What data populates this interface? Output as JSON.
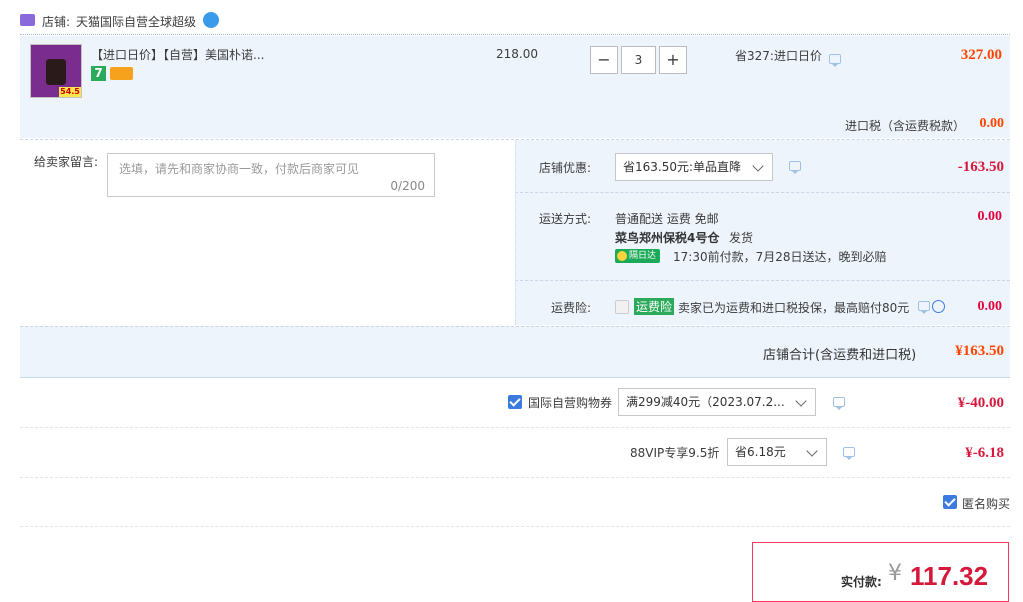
{
  "shop": {
    "label": "店铺:",
    "name": "天猫国际自营全球超级"
  },
  "item": {
    "title": "【进口日价】【自营】美国朴诺...",
    "price": "218.00",
    "qty": "3",
    "minus": "−",
    "plus": "+",
    "save_note": "省327:进口日价",
    "subtotal": "327.00",
    "thumb_price": "54.5",
    "badge7": "7"
  },
  "tax": {
    "label": "进口税（含运费税款）",
    "value": "0.00"
  },
  "message": {
    "label": "给卖家留言:",
    "placeholder": "选填，请先和商家协商一致，付款后商家可见",
    "counter": "0/200"
  },
  "shop_discount": {
    "label": "店铺优惠:",
    "selected": "省163.50元:单品直降",
    "value": "-163.50"
  },
  "shipping": {
    "label": "运送方式:",
    "method": "普通配送 运费 免邮",
    "warehouse": "菜鸟郑州保税4号仓",
    "dispatch": "发货",
    "badge": "隔日达",
    "eta": "17:30前付款，7月28日送达，晚到必赔",
    "value": "0.00"
  },
  "insurance": {
    "label": "运费险:",
    "tag": "运费险",
    "desc": "卖家已为运费和进口税投保，最高赔付80元",
    "value": "0.00"
  },
  "shop_total": {
    "label": "店铺合计(含运费和进口税)",
    "value": "¥163.50"
  },
  "coupon": {
    "label": "国际自营购物券",
    "selected": "满299减40元（2023.07.2...",
    "value": "¥-40.00"
  },
  "vip": {
    "label": "88VIP专享9.5折",
    "selected": "省6.18元",
    "value": "¥-6.18"
  },
  "anonymous": {
    "label": "匿名购买"
  },
  "pay": {
    "label": "实付款:",
    "currency": "¥",
    "amount": "117.32"
  },
  "colors": {
    "accent": "#f40",
    "pay_red": "#d6183a",
    "row_bg": "#eef4fc",
    "checkbox": "#3b7be0"
  }
}
